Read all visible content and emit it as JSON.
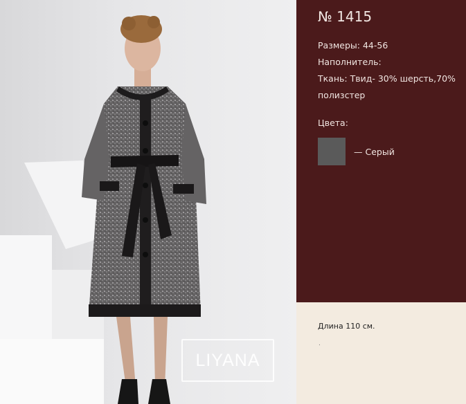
{
  "product": {
    "number": "№ 1415",
    "sizes": "Размеры: 44-56",
    "filling": "Наполнитель:",
    "fabric": "Ткань: Твид- 30% шерсть,70% полизстер",
    "colors_label": "Цвета:",
    "color_option": {
      "label": "— Серый",
      "swatch_color": "#5a5a5a"
    },
    "length": "Длина 110 см.",
    "footnote": "."
  },
  "brand": {
    "logo_text": "LIYANA"
  },
  "colors": {
    "panel": "#4b1a1b",
    "background": "#f3ebe0"
  }
}
